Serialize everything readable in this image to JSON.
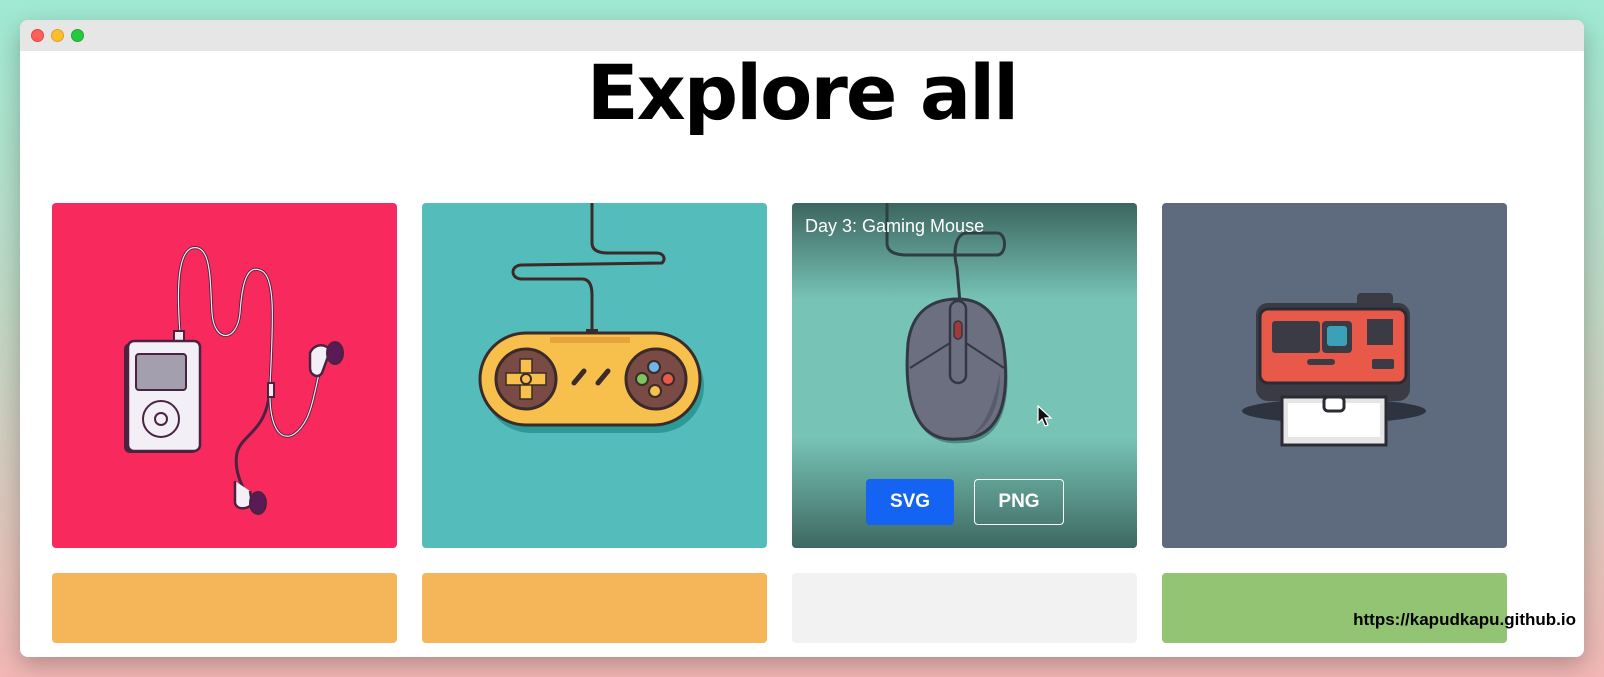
{
  "page": {
    "heading": "Explore all"
  },
  "cards": [
    {
      "name": "ipod-earphones",
      "color": "#f8295d"
    },
    {
      "name": "game-controller",
      "color": "#54bcbb"
    },
    {
      "name": "gaming-mouse",
      "color": "#77c3b6",
      "title": "Day 3: Gaming Mouse",
      "buttons": {
        "svg": "SVG",
        "png": "PNG"
      }
    },
    {
      "name": "instant-camera",
      "color": "#5e6b7e"
    },
    {
      "name": "card-5",
      "color": "#f5b65a"
    },
    {
      "name": "card-6",
      "color": "#f5b65a"
    },
    {
      "name": "card-7",
      "color": "#f2f2f2"
    },
    {
      "name": "card-8",
      "color": "#92c474"
    }
  ],
  "colors": {
    "button_primary": "#1463f3"
  },
  "watermark": "https://kapudkapu.github.io"
}
